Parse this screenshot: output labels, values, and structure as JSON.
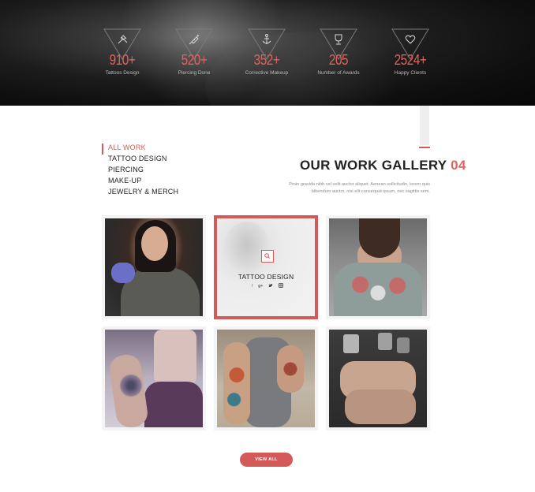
{
  "stats": [
    {
      "icon": "tattoo-machine-icon",
      "value": "910+",
      "label": "Tattoos Design"
    },
    {
      "icon": "syringe-icon",
      "value": "520+",
      "label": "Piercing Done"
    },
    {
      "icon": "anchor-icon",
      "value": "352+",
      "label": "Corrective Makeup"
    },
    {
      "icon": "trophy-icon",
      "value": "205",
      "label": "Number of Awards"
    },
    {
      "icon": "heart-icon",
      "value": "2524+",
      "label": "Happy Clients"
    }
  ],
  "filters": [
    {
      "label": "ALL WORK",
      "active": true
    },
    {
      "label": "TATTOO DESIGN",
      "active": false
    },
    {
      "label": "PIERCING",
      "active": false
    },
    {
      "label": "MAKE-UP",
      "active": false
    },
    {
      "label": "JEWELRY & MERCH",
      "active": false
    }
  ],
  "gallery": {
    "title": "OUR WORK GALLERY",
    "number": "04",
    "description": "Proin gravida nibh vel velit auctor aliquet. Aenean sollicitudin, lorem quis bibendum auctor, nisi elit consequat ipsum, nec sagittis sem.",
    "featured_title": "TATTOO DESIGN",
    "social_icons": [
      "facebook-icon",
      "google-plus-icon",
      "twitter-icon",
      "instagram-icon"
    ],
    "view_all_label": "VIEW ALL"
  },
  "colors": {
    "accent": "#d45a5a",
    "stat_number": "#e0625f",
    "banner_dark": "#0e0e0e"
  }
}
